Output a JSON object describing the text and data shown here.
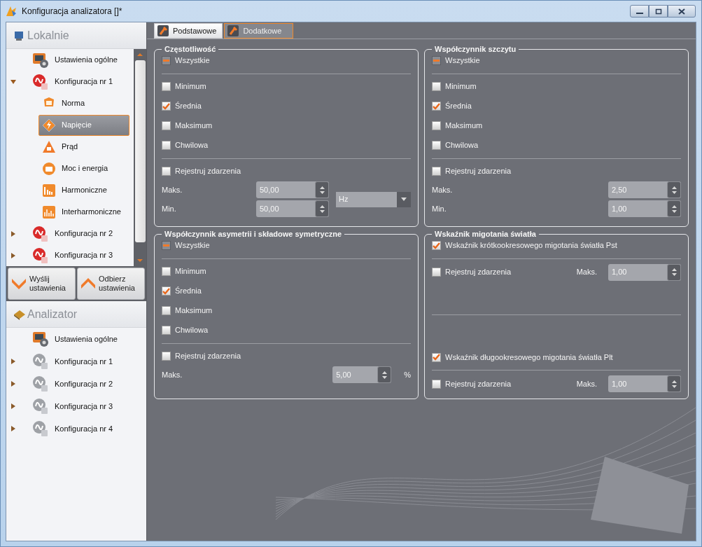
{
  "window": {
    "title": "Konfiguracja analizatora []*"
  },
  "sidebar": {
    "local": {
      "title": "Lokalnie",
      "items": [
        {
          "label": "Ustawienia ogólne",
          "selected": false
        },
        {
          "label": "Konfiguracja nr 1",
          "selected": false,
          "expanded": true,
          "children": [
            {
              "label": "Norma",
              "selected": false
            },
            {
              "label": "Napięcie",
              "selected": true
            },
            {
              "label": "Prąd",
              "selected": false
            },
            {
              "label": "Moc i energia",
              "selected": false
            },
            {
              "label": "Harmoniczne",
              "selected": false
            },
            {
              "label": "Interharmoniczne",
              "selected": false
            }
          ]
        },
        {
          "label": "Konfiguracja nr 2",
          "selected": false,
          "expanded": false
        },
        {
          "label": "Konfiguracja nr 3",
          "selected": false,
          "expanded": false
        }
      ]
    },
    "buttons": [
      {
        "label": "Wyślij ustawienia"
      },
      {
        "label": "Odbierz ustawienia"
      }
    ],
    "device": {
      "title": "Analizator",
      "items": [
        {
          "label": "Ustawienia ogólne",
          "selected": false
        },
        {
          "label": "Konfiguracja nr 1",
          "selected": false,
          "expanded": false
        },
        {
          "label": "Konfiguracja nr 2",
          "selected": false,
          "expanded": false
        },
        {
          "label": "Konfiguracja nr 3",
          "selected": false,
          "expanded": false
        },
        {
          "label": "Konfiguracja nr 4",
          "selected": false,
          "expanded": false
        }
      ]
    }
  },
  "tabs": [
    {
      "label": "Podstawowe",
      "selected": true
    },
    {
      "label": "Dodatkowe",
      "selected": false
    }
  ],
  "groups": [
    {
      "kind": "standard",
      "title": "Częstotliwość",
      "all": {
        "label": "Wszystkie",
        "mixed": true
      },
      "options": [
        {
          "label": "Minimum",
          "checked": false
        },
        {
          "label": "Średnia",
          "checked": true
        },
        {
          "label": "Maksimum",
          "checked": false
        },
        {
          "label": "Chwilowa",
          "checked": false
        }
      ],
      "events": {
        "label": "Rejestruj zdarzenia",
        "checked": false
      },
      "fields": [
        {
          "label": "Maks.",
          "value": "50,00"
        },
        {
          "label": "Min.",
          "value": "50,00"
        }
      ],
      "unit_select": "Hz"
    },
    {
      "kind": "standard",
      "title": "Współczynnik szczytu",
      "all": {
        "label": "Wszystkie",
        "mixed": true
      },
      "options": [
        {
          "label": "Minimum",
          "checked": false
        },
        {
          "label": "Średnia",
          "checked": true
        },
        {
          "label": "Maksimum",
          "checked": false
        },
        {
          "label": "Chwilowa",
          "checked": false
        }
      ],
      "events": {
        "label": "Rejestruj zdarzenia",
        "checked": false
      },
      "fields": [
        {
          "label": "Maks.",
          "value": "2,50"
        },
        {
          "label": "Min.",
          "value": "1,00"
        }
      ]
    },
    {
      "kind": "standard",
      "title": "Współczynnik asymetrii i składowe symetryczne",
      "all": {
        "label": "Wszystkie",
        "mixed": true
      },
      "options": [
        {
          "label": "Minimum",
          "checked": false
        },
        {
          "label": "Średnia",
          "checked": true
        },
        {
          "label": "Maksimum",
          "checked": false
        },
        {
          "label": "Chwilowa",
          "checked": false
        }
      ],
      "events": {
        "label": "Rejestruj zdarzenia",
        "checked": false
      },
      "fields": [
        {
          "label": "Maks.",
          "value": "5,00",
          "unit": "%"
        }
      ]
    },
    {
      "kind": "flicker",
      "title": "Wskaźnik migotania światła",
      "indices": [
        {
          "label": "Wskaźnik krótkookresowego migotania światła Pst",
          "checked": true,
          "events": {
            "label": "Rejestruj zdarzenia",
            "checked": false
          },
          "field": {
            "label": "Maks.",
            "value": "1,00"
          }
        },
        {
          "label": "Wskaźnik długookresowego migotania światła Plt",
          "checked": true,
          "events": {
            "label": "Rejestruj zdarzenia",
            "checked": false
          },
          "field": {
            "label": "Maks.",
            "value": "1,00"
          }
        }
      ]
    }
  ]
}
